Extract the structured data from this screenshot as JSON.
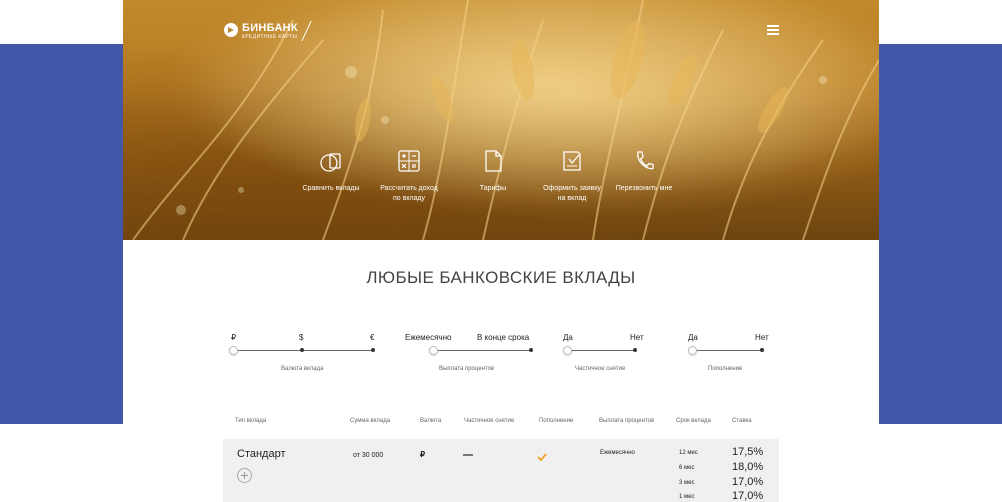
{
  "header": {
    "logo_name": "БИНБАНК",
    "logo_sub": "КРЕДИТНЫЕ КАРТЫ"
  },
  "actions": [
    {
      "label_1": "Сравнить вклады",
      "label_2": "",
      "icon": "compare-icon"
    },
    {
      "label_1": "Рассчитать доход",
      "label_2": "по вкладу",
      "icon": "calculator-icon"
    },
    {
      "label_1": "Тарифы",
      "label_2": "",
      "icon": "document-icon"
    },
    {
      "label_1": "Оформить заявку",
      "label_2": "на вклад",
      "icon": "application-icon"
    },
    {
      "label_1": "Перезвонить мне",
      "label_2": "",
      "icon": "phone-icon"
    }
  ],
  "section_title": "ЛЮБЫЕ БАНКОВСКИЕ ВКЛАДЫ",
  "filters": [
    {
      "options": [
        "₽",
        "$",
        "€"
      ],
      "caption": "Валюта вклада",
      "selected": 0
    },
    {
      "options": [
        "Ежемесячно",
        "В конце срока"
      ],
      "caption": "Выплата процентов",
      "selected": 0
    },
    {
      "options": [
        "Да",
        "Нет"
      ],
      "caption": "Частичное снятие",
      "selected": 0
    },
    {
      "options": [
        "Да",
        "Нет"
      ],
      "caption": "Пополнение",
      "selected": 0
    }
  ],
  "table": {
    "columns": [
      "Тип вклада",
      "Сумма вклада",
      "Валюта",
      "Частичное снятие",
      "Пополнение",
      "Выплата процентов",
      "Срок вклада",
      "Ставка"
    ],
    "rows": [
      {
        "type": "Стандарт",
        "amount": "от 30 000",
        "currency": "₽",
        "partial_withdrawal": "—",
        "replenishment_icon": "checkmark-icon",
        "payout": "Ежемесячно",
        "terms": [
          {
            "term": "12 мес",
            "rate": "17,5%"
          },
          {
            "term": "6 мес",
            "rate": "18,0%"
          },
          {
            "term": "3 мес",
            "rate": "17,0%"
          },
          {
            "term": "1 мес",
            "rate": "17,0%"
          }
        ]
      }
    ]
  },
  "colors": {
    "blue_band": "#4357a8",
    "accent_orange": "#f0a020",
    "row_bg": "#f0f0f0"
  }
}
